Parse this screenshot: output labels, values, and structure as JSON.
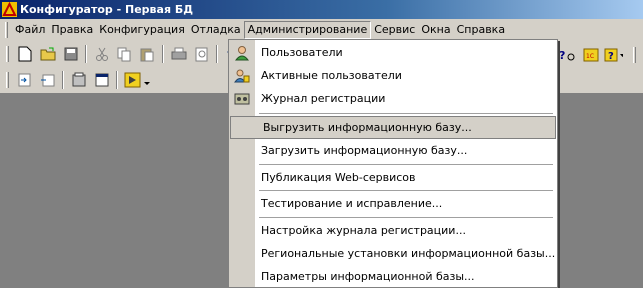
{
  "window": {
    "title": "Конфигуратор - Первая БД"
  },
  "menubar": {
    "items": [
      {
        "label": "Файл"
      },
      {
        "label": "Правка"
      },
      {
        "label": "Конфигурация"
      },
      {
        "label": "Отладка"
      },
      {
        "label": "Администрирование"
      },
      {
        "label": "Сервис"
      },
      {
        "label": "Окна"
      },
      {
        "label": "Справка"
      }
    ]
  },
  "admin_menu": {
    "items": [
      {
        "label": "Пользователи",
        "icon": "user-icon"
      },
      {
        "label": "Активные пользователи",
        "icon": "active-users-icon"
      },
      {
        "label": "Журнал регистрации",
        "icon": "log-icon"
      },
      {
        "label": "Выгрузить информационную базу...",
        "highlighted": true
      },
      {
        "label": "Загрузить информационную базу..."
      },
      {
        "label": "Публикация Web-сервисов"
      },
      {
        "label": "Тестирование и исправление..."
      },
      {
        "label": "Настройка журнала регистрации..."
      },
      {
        "label": "Региональные установки информационной базы..."
      },
      {
        "label": "Параметры информационной базы..."
      }
    ]
  },
  "colors": {
    "titlebar": "#0a246a",
    "face": "#d4d0c8",
    "workspace": "#808080",
    "highlight": "#d4d0c8"
  }
}
